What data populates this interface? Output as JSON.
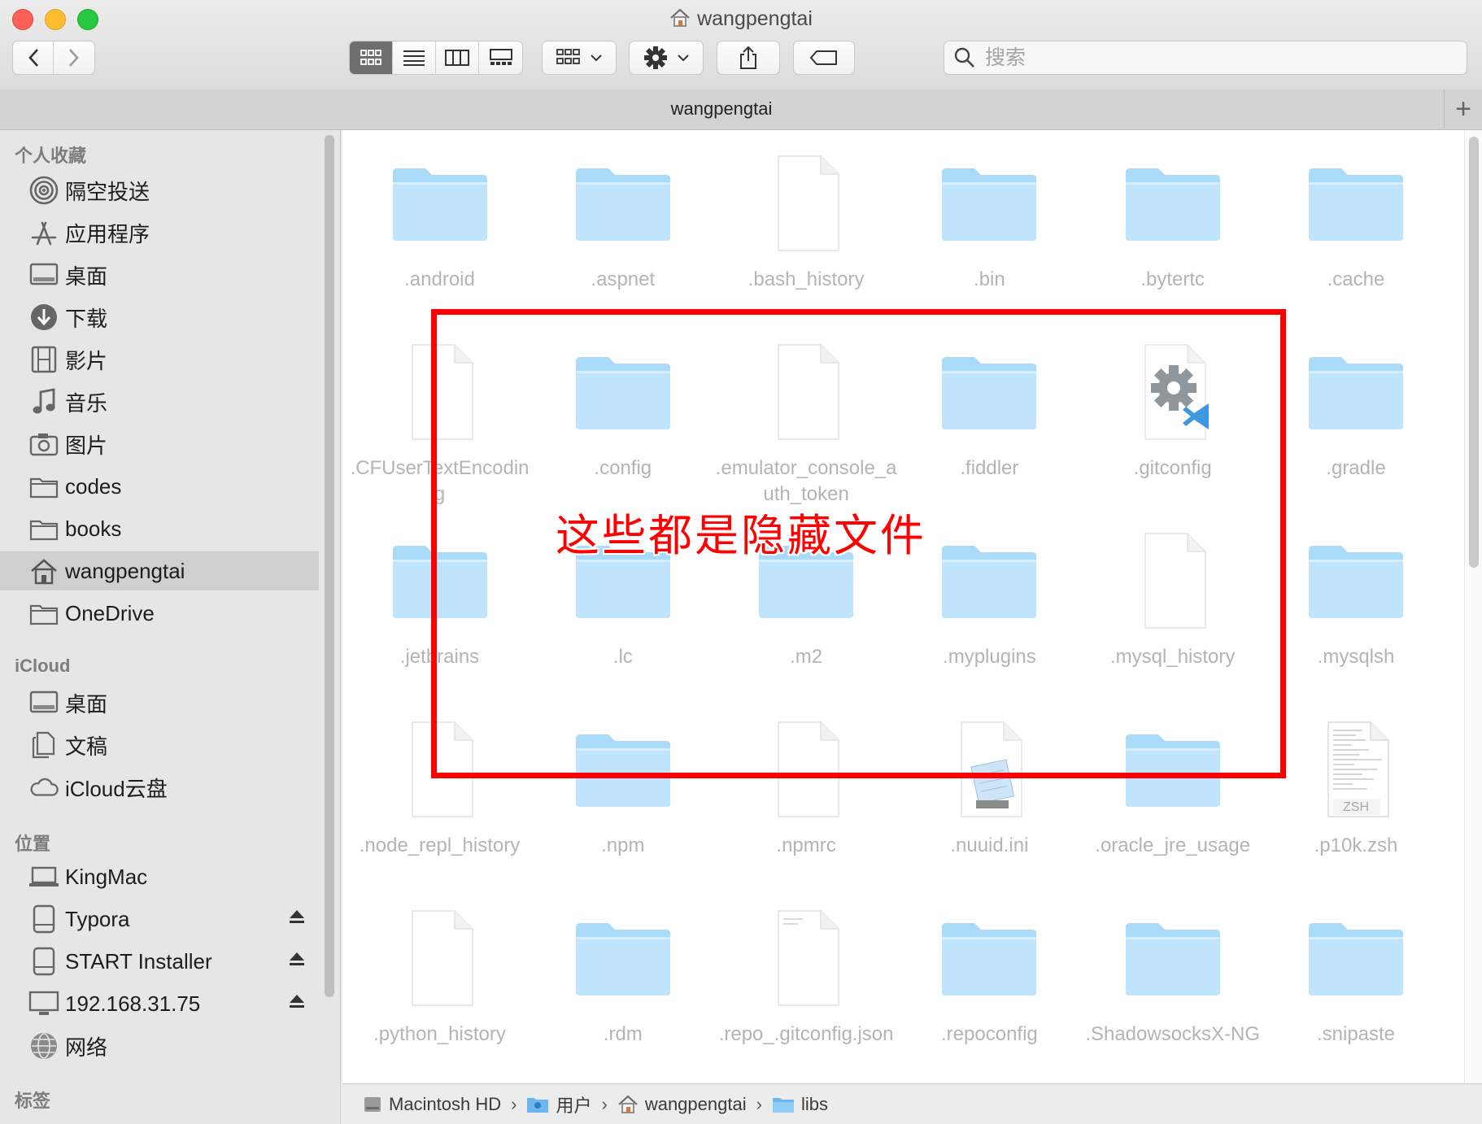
{
  "window": {
    "title": "wangpengtai",
    "tab_label": "wangpengtai"
  },
  "toolbar": {
    "search_placeholder": "搜索"
  },
  "sidebar": {
    "favorites_header": "个人收藏",
    "favorites": [
      {
        "label": "隔空投送",
        "icon": "airdrop-icon"
      },
      {
        "label": "应用程序",
        "icon": "applications-icon"
      },
      {
        "label": "桌面",
        "icon": "desktop-icon"
      },
      {
        "label": "下载",
        "icon": "downloads-icon"
      },
      {
        "label": "影片",
        "icon": "movies-icon"
      },
      {
        "label": "音乐",
        "icon": "music-icon"
      },
      {
        "label": "图片",
        "icon": "pictures-icon"
      },
      {
        "label": "codes",
        "icon": "folder-icon"
      },
      {
        "label": "books",
        "icon": "folder-icon"
      },
      {
        "label": "wangpengtai",
        "icon": "home-icon",
        "selected": true
      },
      {
        "label": "OneDrive",
        "icon": "folder-icon"
      }
    ],
    "icloud_header": "iCloud",
    "icloud": [
      {
        "label": "桌面",
        "icon": "desktop-icon"
      },
      {
        "label": "文稿",
        "icon": "documents-icon"
      },
      {
        "label": "iCloud云盘",
        "icon": "cloud-icon"
      }
    ],
    "locations_header": "位置",
    "locations": [
      {
        "label": "KingMac",
        "icon": "laptop-icon"
      },
      {
        "label": "Typora",
        "icon": "disk-icon",
        "eject": true
      },
      {
        "label": "START Installer",
        "icon": "disk-icon",
        "eject": true
      },
      {
        "label": "192.168.31.75",
        "icon": "display-icon",
        "eject": true
      },
      {
        "label": "网络",
        "icon": "network-icon"
      }
    ],
    "tags_header": "标签"
  },
  "files": [
    {
      "name": ".android",
      "kind": "folder"
    },
    {
      "name": ".aspnet",
      "kind": "folder"
    },
    {
      "name": ".bash_history",
      "kind": "doc"
    },
    {
      "name": ".bin",
      "kind": "folder"
    },
    {
      "name": ".bytertc",
      "kind": "folder"
    },
    {
      "name": ".cache",
      "kind": "folder"
    },
    {
      "name": ".CFUserTextEncoding",
      "kind": "doc"
    },
    {
      "name": ".config",
      "kind": "folder"
    },
    {
      "name": ".emulator_console_auth_token",
      "kind": "doc"
    },
    {
      "name": ".fiddler",
      "kind": "folder"
    },
    {
      "name": ".gitconfig",
      "kind": "gitconfig"
    },
    {
      "name": ".gradle",
      "kind": "folder"
    },
    {
      "name": ".jetbrains",
      "kind": "folder"
    },
    {
      "name": ".lc",
      "kind": "folder"
    },
    {
      "name": ".m2",
      "kind": "folder"
    },
    {
      "name": ".myplugins",
      "kind": "folder"
    },
    {
      "name": ".mysql_history",
      "kind": "doc"
    },
    {
      "name": ".mysqlsh",
      "kind": "folder"
    },
    {
      "name": ".node_repl_history",
      "kind": "doc"
    },
    {
      "name": ".npm",
      "kind": "folder"
    },
    {
      "name": ".npmrc",
      "kind": "doc"
    },
    {
      "name": ".nuuid.ini",
      "kind": "notepad"
    },
    {
      "name": ".oracle_jre_usage",
      "kind": "folder"
    },
    {
      "name": ".p10k.zsh",
      "kind": "zsh"
    },
    {
      "name": ".python_history",
      "kind": "doc"
    },
    {
      "name": ".rdm",
      "kind": "folder"
    },
    {
      "name": ".repo_.gitconfig.json",
      "kind": "textdoc"
    },
    {
      "name": ".repoconfig",
      "kind": "folder"
    },
    {
      "name": ".ShadowsocksX-NG",
      "kind": "folder"
    },
    {
      "name": ".snipaste",
      "kind": "folder"
    }
  ],
  "zsh_badge": "ZSH",
  "annotation": {
    "text": "这些都是隐藏文件",
    "color": "#ff0000"
  },
  "pathbar": [
    {
      "label": "Macintosh HD",
      "icon": "hard-drive-icon"
    },
    {
      "label": "用户",
      "icon": "users-folder-icon"
    },
    {
      "label": "wangpengtai",
      "icon": "home-icon"
    },
    {
      "label": "libs",
      "icon": "folder-icon"
    }
  ],
  "colors": {
    "folder": "#bfe4fb",
    "selection": "#cfcfcf",
    "accent_red": "#ff0000"
  }
}
